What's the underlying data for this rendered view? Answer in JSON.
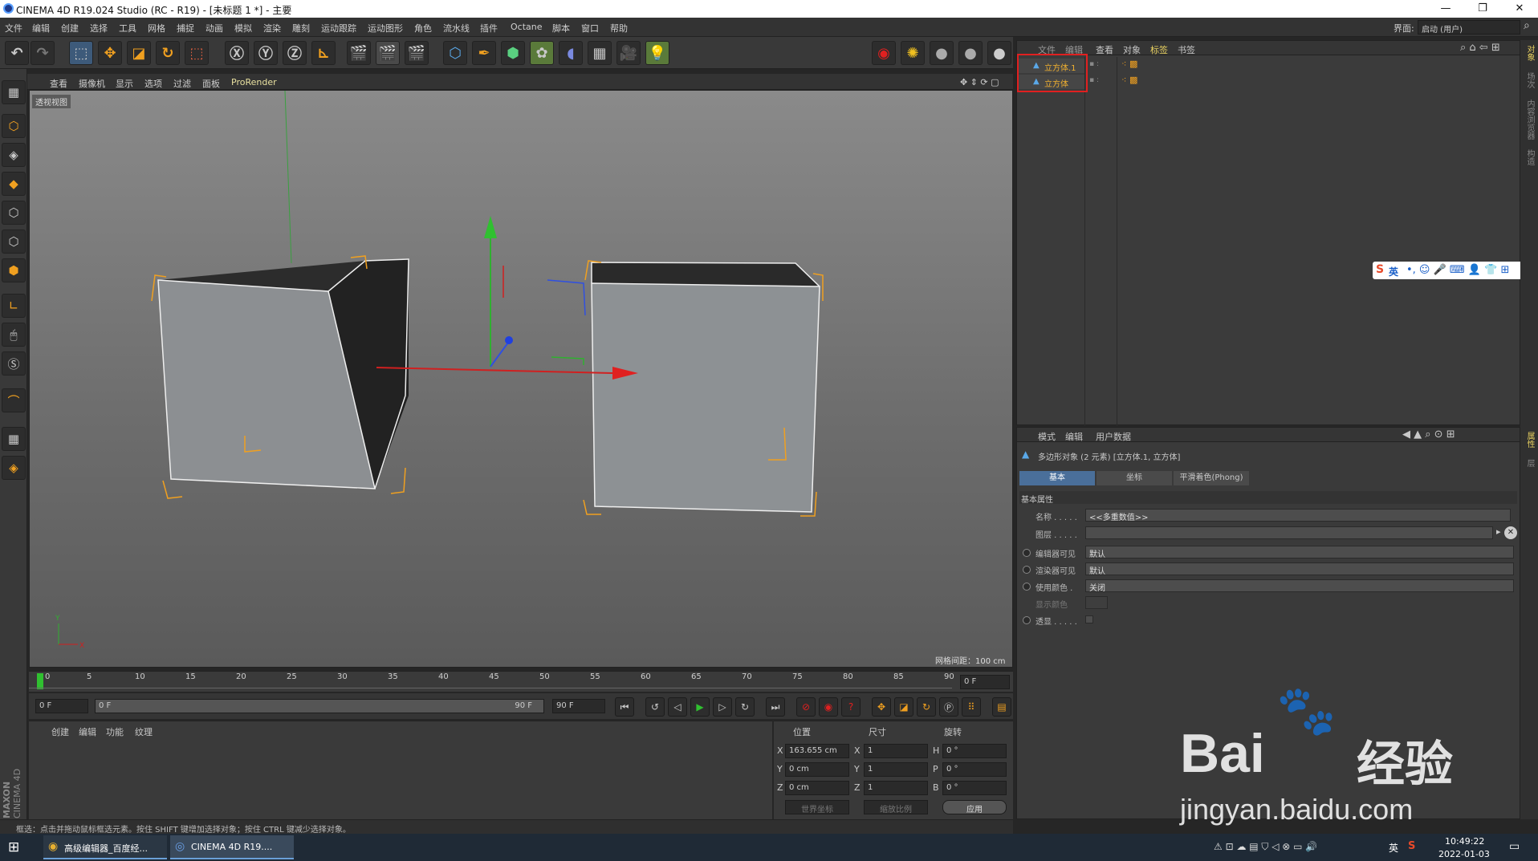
{
  "window": {
    "title": "CINEMA 4D R19.024 Studio (RC - R19) - [未标题 1 *] - 主要",
    "minimize": "—",
    "maximize": "❐",
    "close": "✕"
  },
  "menu": [
    "文件",
    "编辑",
    "创建",
    "选择",
    "工具",
    "网格",
    "捕捉",
    "动画",
    "模拟",
    "渲染",
    "雕刻",
    "运动跟踪",
    "运动图形",
    "角色",
    "流水线",
    "插件",
    "Octane",
    "脚本",
    "窗口",
    "帮助"
  ],
  "interface_label": "界面:",
  "interface_value": "启动 (用户)",
  "viewport_menu": [
    "查看",
    "摄像机",
    "显示",
    "选项",
    "过滤",
    "面板",
    "ProRender"
  ],
  "viewport_label": "透视视图",
  "grid_info": "网格间距：100 cm",
  "axis_x": "X",
  "axis_y": "Y",
  "axis_z": "Z",
  "timeline": {
    "ticks": [
      "0",
      "5",
      "10",
      "15",
      "20",
      "25",
      "30",
      "35",
      "40",
      "45",
      "50",
      "55",
      "60",
      "65",
      "70",
      "75",
      "80",
      "85",
      "90"
    ],
    "current": "0 F",
    "start": "0 F",
    "range_start": "0 F",
    "range_end": "90 F",
    "end": "90 F"
  },
  "material_menu": [
    "创建",
    "编辑",
    "功能",
    "纹理"
  ],
  "coord": {
    "headers": [
      "位置",
      "尺寸",
      "旋转"
    ],
    "rows": [
      {
        "axis": "X",
        "pos": "163.655 cm",
        "sz": "X",
        "size": "1",
        "rot_axis": "H",
        "rot": "0 °"
      },
      {
        "axis": "Y",
        "pos": "0 cm",
        "sz": "Y",
        "size": "1",
        "rot_axis": "P",
        "rot": "0 °"
      },
      {
        "axis": "Z",
        "pos": "0 cm",
        "sz": "Z",
        "size": "1",
        "rot_axis": "B",
        "rot": "0 °"
      }
    ],
    "world": "世界坐标",
    "scale": "缩放比例",
    "apply": "应用"
  },
  "status": "框选：点击并拖动鼠标框选元素。按住 SHIFT 键增加选择对象；按住 CTRL 键减少选择对象。",
  "object_manager": {
    "tabs": [
      "文件",
      "编辑",
      "查看",
      "对象",
      "标签",
      "书签"
    ],
    "objects": [
      "立方体.1",
      "立方体"
    ],
    "highlight_color": "#e02020"
  },
  "attributes": {
    "menu": [
      "模式",
      "编辑",
      "用户数据"
    ],
    "summary": "多边形对象 (2 元素) [立方体.1, 立方体]",
    "tabs": [
      "基本",
      "坐标",
      "平滑着色(Phong)"
    ],
    "section": "基本属性",
    "fields": [
      {
        "label": "名称 . . . . .",
        "value": "<<多重数值>>"
      },
      {
        "label": "图层 . . . . .",
        "value": ""
      },
      {
        "label": "编辑器可见",
        "value": "默认"
      },
      {
        "label": "渲染器可见",
        "value": "默认"
      },
      {
        "label": "使用颜色 .",
        "value": "关闭"
      },
      {
        "label": "显示颜色",
        "value": ""
      },
      {
        "label": "透显 . . . . .",
        "value": ""
      }
    ]
  },
  "side_tabs": [
    "对象",
    "场次",
    "内容浏览器",
    "构造",
    "属性",
    "层"
  ],
  "ime": "英",
  "brand": [
    "MAXON",
    "CINEMA 4D"
  ],
  "taskbar": {
    "apps": [
      "高级编辑器_百度经...",
      "CINEMA 4D R19...."
    ],
    "time": "10:49:22",
    "date": "2022-01-03",
    "lang": "英"
  },
  "watermark": {
    "brand": "Bai",
    "brand_cn": "经验",
    "url": "jingyan.baidu.com"
  }
}
